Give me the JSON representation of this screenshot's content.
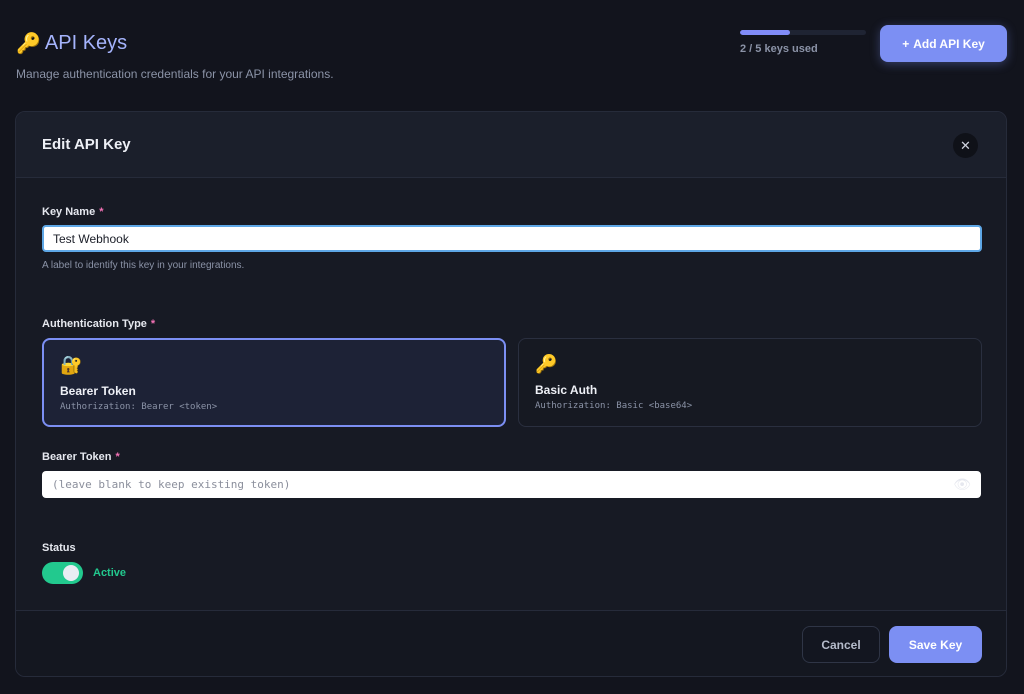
{
  "page": {
    "icon": "key-icon",
    "title": "API Keys",
    "subtitle": "Manage authentication credentials for your API integrations."
  },
  "usage": {
    "used": 2,
    "total": 5,
    "label": "2 / 5 keys used"
  },
  "add_button": {
    "icon": "plus-icon",
    "label": "Add API Key"
  },
  "modal": {
    "title": "Edit API Key",
    "close_glyph": "✕",
    "key_name": {
      "label": "Key Name",
      "required_mark": "*",
      "value": "Test Webhook",
      "hint": "A label to identify this key in your integrations."
    },
    "auth_type": {
      "label": "Authentication Type",
      "required_mark": "*",
      "options": [
        {
          "icon": "locked-key-icon",
          "glyph": "🔐",
          "title": "Bearer Token",
          "description": "Authorization: Bearer <token>",
          "selected": true
        },
        {
          "icon": "key-icon",
          "glyph": "🔑",
          "title": "Basic Auth",
          "description": "Authorization: Basic <base64>",
          "selected": false
        }
      ]
    },
    "bearer_token": {
      "label": "Bearer Token",
      "required_mark": "*",
      "placeholder": "(leave blank to keep existing token)",
      "eye_glyph": "👁"
    },
    "status": {
      "label": "Status",
      "value": "Active",
      "enabled": true
    },
    "footer": {
      "cancel_label": "Cancel",
      "save_label": "Save Key"
    }
  },
  "colors": {
    "accent": "#7c8ff3",
    "active_green": "#22c98e",
    "required": "#f472b6",
    "background": "#12141d"
  }
}
